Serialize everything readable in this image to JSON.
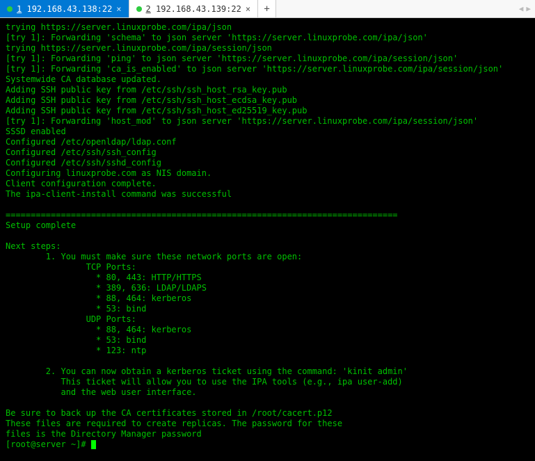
{
  "tabs": [
    {
      "index": "1",
      "label": "192.168.43.138:22",
      "active": true
    },
    {
      "index": "2",
      "label": "192.168.43.139:22",
      "active": false
    }
  ],
  "nav": {
    "left": "◀",
    "right": "▶"
  },
  "terminal_lines": [
    "trying https://server.linuxprobe.com/ipa/json",
    "[try 1]: Forwarding 'schema' to json server 'https://server.linuxprobe.com/ipa/json'",
    "trying https://server.linuxprobe.com/ipa/session/json",
    "[try 1]: Forwarding 'ping' to json server 'https://server.linuxprobe.com/ipa/session/json'",
    "[try 1]: Forwarding 'ca_is_enabled' to json server 'https://server.linuxprobe.com/ipa/session/json'",
    "Systemwide CA database updated.",
    "Adding SSH public key from /etc/ssh/ssh_host_rsa_key.pub",
    "Adding SSH public key from /etc/ssh/ssh_host_ecdsa_key.pub",
    "Adding SSH public key from /etc/ssh/ssh_host_ed25519_key.pub",
    "[try 1]: Forwarding 'host_mod' to json server 'https://server.linuxprobe.com/ipa/session/json'",
    "SSSD enabled",
    "Configured /etc/openldap/ldap.conf",
    "Configured /etc/ssh/ssh_config",
    "Configured /etc/ssh/sshd_config",
    "Configuring linuxprobe.com as NIS domain.",
    "Client configuration complete.",
    "The ipa-client-install command was successful",
    "",
    "==============================================================================",
    "Setup complete",
    "",
    "Next steps:",
    "        1. You must make sure these network ports are open:",
    "                TCP Ports:",
    "                  * 80, 443: HTTP/HTTPS",
    "                  * 389, 636: LDAP/LDAPS",
    "                  * 88, 464: kerberos",
    "                  * 53: bind",
    "                UDP Ports:",
    "                  * 88, 464: kerberos",
    "                  * 53: bind",
    "                  * 123: ntp",
    "",
    "        2. You can now obtain a kerberos ticket using the command: 'kinit admin'",
    "           This ticket will allow you to use the IPA tools (e.g., ipa user-add)",
    "           and the web user interface.",
    "",
    "Be sure to back up the CA certificates stored in /root/cacert.p12",
    "These files are required to create replicas. The password for these",
    "files is the Directory Manager password"
  ],
  "prompt": "[root@server ~]# "
}
